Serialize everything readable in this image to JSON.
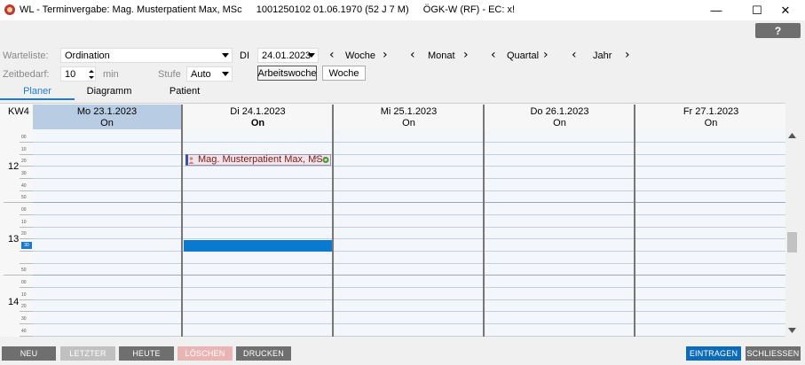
{
  "window": {
    "title": "WL - Terminvergabe: Mag. Musterpatient Max, MSc",
    "patient_info": "1001250102 01.06.1970 (52 J 7 M)",
    "insurance": "ÖGK-W (RF) - EC: x!",
    "minimize": "—",
    "maximize": "☐",
    "close": "✕"
  },
  "help_label": "?",
  "toolbar": {
    "warteliste_label": "Warteliste:",
    "warteliste_value": "Ordination",
    "day_abbrev": "DI",
    "date_value": "24.01.2023",
    "zeitbedarf_label": "Zeitbedarf:",
    "zeitbedarf_value": "10",
    "min_label": "min",
    "stufe_label": "Stufe",
    "stufe_value": "Auto",
    "nav": {
      "woche": "Woche",
      "monat": "Monat",
      "quartal": "Quartal",
      "jahr": "Jahr",
      "prev": "‹",
      "next": "›"
    },
    "arbeitswoche_label": "Arbeitswoche",
    "woche_button_label": "Woche"
  },
  "tabs": [
    {
      "label": "Planer",
      "active": true
    },
    {
      "label": "Diagramm",
      "active": false
    },
    {
      "label": "Patient",
      "active": false
    }
  ],
  "calendar": {
    "week_label": "KW4",
    "days": [
      {
        "date": "Mo 23.1.2023",
        "status": "On",
        "selected": true
      },
      {
        "date": "Di 24.1.2023",
        "status": "On",
        "bold": true
      },
      {
        "date": "Mi 25.1.2023",
        "status": "On"
      },
      {
        "date": "Do 26.1.2023",
        "status": "On"
      },
      {
        "date": "Fr 27.1.2023",
        "status": "On"
      }
    ],
    "hours": [
      "12",
      "13",
      "14"
    ],
    "minutes": [
      "00",
      "10",
      "20",
      "30",
      "40",
      "50"
    ],
    "current_minute": "30",
    "event": {
      "label": "Mag. Musterpatient Max, MSc",
      "day": "Di 24.1.2023",
      "start": "12:20"
    },
    "selected_slot": {
      "day": "Di 24.1.2023",
      "start": "13:30"
    }
  },
  "buttons": {
    "neu": "NEU",
    "letzter": "LETZTER",
    "heute": "HEUTE",
    "loeschen": "LÖSCHEN",
    "drucken": "DRUCKEN",
    "eintragen": "EINTRAGEN",
    "schliessen": "SCHLIESSEN"
  },
  "colors": {
    "accent": "#1f7ad6",
    "button_gray": "#6f6f6f",
    "button_disabled": "#c0c0c0",
    "button_danger_disabled": "#e8b4b4",
    "button_primary": "#0b6bb8",
    "selected_day": "#b8cce4"
  }
}
